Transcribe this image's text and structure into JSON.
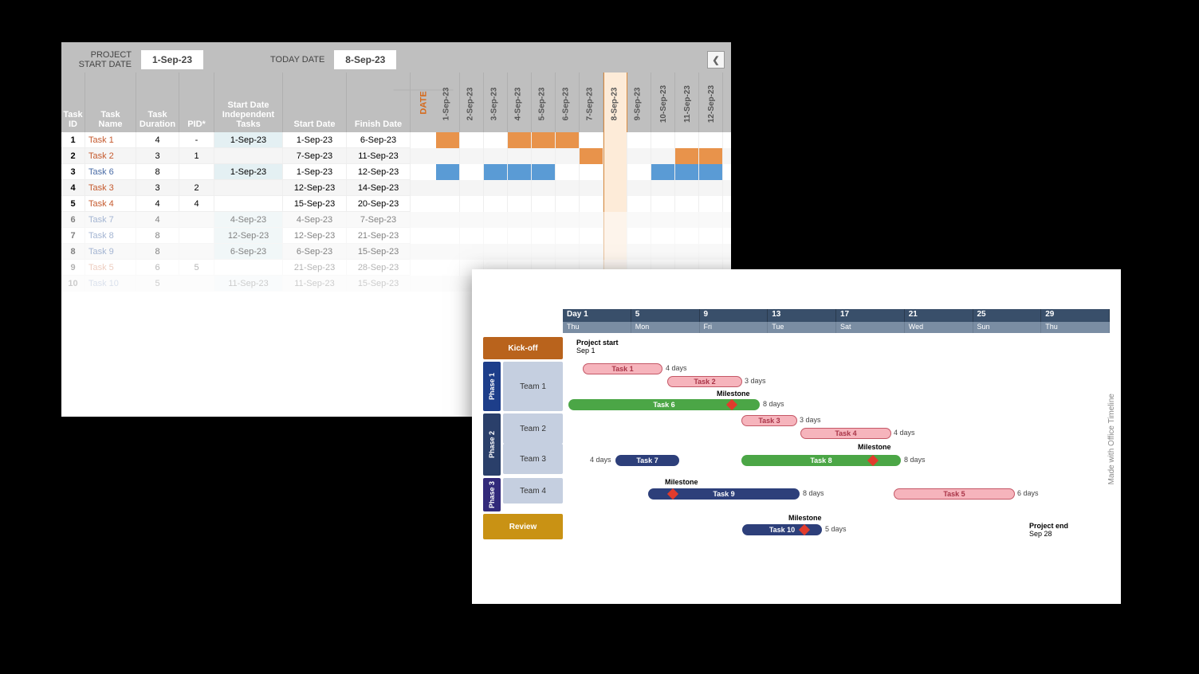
{
  "spreadsheet": {
    "project_start_label": "PROJECT START DATE",
    "project_start_date": "1-Sep-23",
    "today_date_label": "TODAY DATE",
    "today_date": "8-Sep-23",
    "columns": {
      "id": "Task ID",
      "name": "Task Name",
      "dur": "Task Duration",
      "pid": "PID*",
      "sdi": "Start Date Independent Tasks",
      "sd": "Start Date",
      "fd": "Finish Date"
    },
    "date_header_label": "DATE",
    "date_cols": [
      "1-Sep-23",
      "2-Sep-23",
      "3-Sep-23",
      "4-Sep-23",
      "5-Sep-23",
      "6-Sep-23",
      "7-Sep-23",
      "8-Sep-23",
      "9-Sep-23",
      "10-Sep-23",
      "11-Sep-23",
      "12-Sep-23"
    ],
    "highlight_date_index": 7,
    "rows": [
      {
        "id": "1",
        "name": "Task 1",
        "dur": "4",
        "pid": "-",
        "sdi": "1-Sep-23",
        "sd": "1-Sep-23",
        "fd": "6-Sep-23",
        "color": "orange",
        "bar": [
          0,
          5
        ]
      },
      {
        "id": "2",
        "name": "Task 2",
        "dur": "3",
        "pid": "1",
        "sdi": "",
        "sd": "7-Sep-23",
        "fd": "11-Sep-23",
        "color": "orange",
        "bar": [
          6,
          11
        ]
      },
      {
        "id": "3",
        "name": "Task 6",
        "dur": "8",
        "pid": "",
        "sdi": "1-Sep-23",
        "sd": "1-Sep-23",
        "fd": "12-Sep-23",
        "color": "blue",
        "bar": [
          0,
          11
        ]
      },
      {
        "id": "4",
        "name": "Task 3",
        "dur": "3",
        "pid": "2",
        "sdi": "",
        "sd": "12-Sep-23",
        "fd": "14-Sep-23",
        "color": "orange",
        "bar": null
      },
      {
        "id": "5",
        "name": "Task 4",
        "dur": "4",
        "pid": "4",
        "sdi": "",
        "sd": "15-Sep-23",
        "fd": "20-Sep-23",
        "color": "orange",
        "bar": null
      },
      {
        "id": "6",
        "name": "Task 7",
        "dur": "4",
        "pid": "",
        "sdi": "4-Sep-23",
        "sd": "4-Sep-23",
        "fd": "7-Sep-23",
        "color": "blue",
        "bar": null
      },
      {
        "id": "7",
        "name": "Task 8",
        "dur": "8",
        "pid": "",
        "sdi": "12-Sep-23",
        "sd": "12-Sep-23",
        "fd": "21-Sep-23",
        "color": "blue",
        "bar": null
      },
      {
        "id": "8",
        "name": "Task 9",
        "dur": "8",
        "pid": "",
        "sdi": "6-Sep-23",
        "sd": "6-Sep-23",
        "fd": "15-Sep-23",
        "color": "blue",
        "bar": null
      },
      {
        "id": "9",
        "name": "Task 5",
        "dur": "6",
        "pid": "5",
        "sdi": "",
        "sd": "21-Sep-23",
        "fd": "28-Sep-23",
        "color": "orange",
        "bar": null
      },
      {
        "id": "10",
        "name": "Task 10",
        "dur": "5",
        "pid": "",
        "sdi": "11-Sep-23",
        "sd": "11-Sep-23",
        "fd": "15-Sep-23",
        "color": "blue",
        "bar": null
      }
    ]
  },
  "timeline": {
    "header_days": [
      "Day 1",
      "5",
      "9",
      "13",
      "17",
      "21",
      "25",
      "29"
    ],
    "header_dows": [
      "Thu",
      "Mon",
      "Fri",
      "Tue",
      "Sat",
      "Wed",
      "Sun",
      "Thu"
    ],
    "lanes": {
      "kickoff": "Kick-off",
      "phase1": "Phase 1",
      "team1": "Team 1",
      "phase2": "Phase 2",
      "team2": "Team 2",
      "team3": "Team 3",
      "phase3": "Phase 3",
      "team4": "Team 4",
      "review": "Review"
    },
    "project_start": {
      "label": "Project start",
      "date": "Sep 1"
    },
    "project_end": {
      "label": "Project end",
      "date": "Sep 28"
    },
    "bars": {
      "t1": {
        "name": "Task 1",
        "dur": "4 days"
      },
      "t2": {
        "name": "Task 2",
        "dur": "3 days"
      },
      "t6": {
        "name": "Task 6",
        "dur": "8 days"
      },
      "t3": {
        "name": "Task 3",
        "dur": "3 days"
      },
      "t4": {
        "name": "Task 4",
        "dur": "4 days"
      },
      "t7": {
        "name": "Task 7",
        "dur": "4 days"
      },
      "t8": {
        "name": "Task 8",
        "dur": "8 days"
      },
      "t9": {
        "name": "Task 9",
        "dur": "8 days"
      },
      "t5": {
        "name": "Task 5",
        "dur": "6 days"
      },
      "t10": {
        "name": "Task 10",
        "dur": "5 days"
      }
    },
    "milestone_label": "Milestone",
    "watermark": "Made with      Office Timeline"
  }
}
